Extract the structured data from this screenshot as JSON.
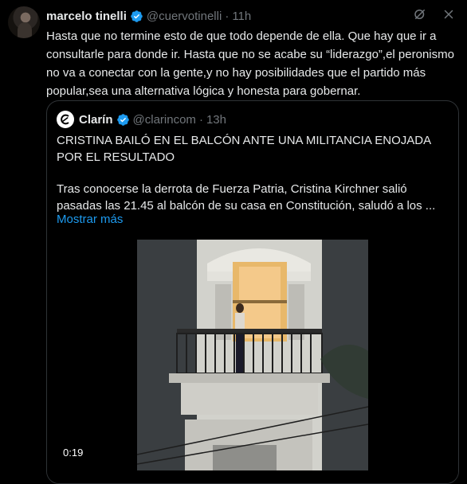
{
  "tweet": {
    "author_name": "marcelo tinelli",
    "handle": "@cuervotinelli",
    "separator": "·",
    "time": "11h",
    "text": "Hasta que no termine esto de que todo depende de ella. Que hay que ir a consultarle para donde ir. Hasta que no se acabe su “liderazgo”,el peronismo no va a conectar con la gente,y no hay posibilidades que el partido más popular,sea una alternativa lógica y honesta para gobernar."
  },
  "quote": {
    "author_name": "Clarín",
    "handle": "@clarincom",
    "separator": "·",
    "time": "13h",
    "headline": "CRISTINA BAILÓ EN EL BALCÓN ANTE UNA MILITANCIA ENOJADA POR EL RESULTADO",
    "body": "Tras conocerse la derrota de Fuerza Patria, Cristina Kirchner salió pasadas las 21.45 al balcón de su casa en Constitución, saludó a los ...",
    "show_more": "Mostrar más",
    "video_duration": "0:19"
  },
  "colors": {
    "background": "#000000",
    "text": "#e7e9ea",
    "secondary": "#71767b",
    "link": "#1d9bf0",
    "verified": "#1d9bf0",
    "border": "#2f3336"
  },
  "icons": {
    "verified": "verified-badge-icon",
    "grok": "grok-icon",
    "close": "close-icon"
  }
}
